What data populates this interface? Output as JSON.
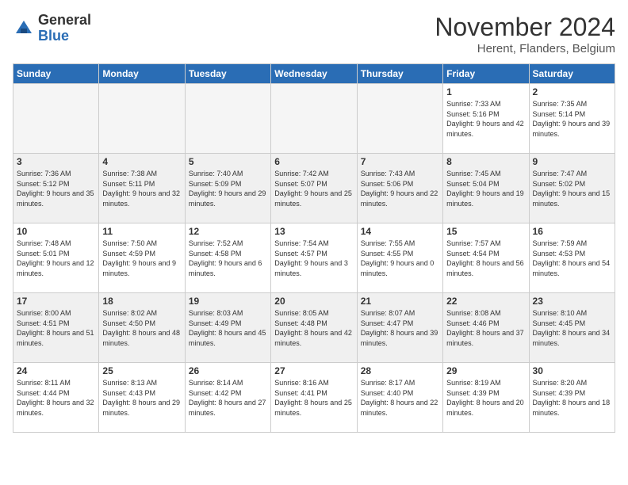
{
  "logo": {
    "general": "General",
    "blue": "Blue"
  },
  "title": "November 2024",
  "location": "Herent, Flanders, Belgium",
  "headers": [
    "Sunday",
    "Monday",
    "Tuesday",
    "Wednesday",
    "Thursday",
    "Friday",
    "Saturday"
  ],
  "weeks": [
    {
      "shaded": false,
      "days": [
        {
          "num": "",
          "info": ""
        },
        {
          "num": "",
          "info": ""
        },
        {
          "num": "",
          "info": ""
        },
        {
          "num": "",
          "info": ""
        },
        {
          "num": "",
          "info": ""
        },
        {
          "num": "1",
          "info": "Sunrise: 7:33 AM\nSunset: 5:16 PM\nDaylight: 9 hours\nand 42 minutes."
        },
        {
          "num": "2",
          "info": "Sunrise: 7:35 AM\nSunset: 5:14 PM\nDaylight: 9 hours\nand 39 minutes."
        }
      ]
    },
    {
      "shaded": true,
      "days": [
        {
          "num": "3",
          "info": "Sunrise: 7:36 AM\nSunset: 5:12 PM\nDaylight: 9 hours\nand 35 minutes."
        },
        {
          "num": "4",
          "info": "Sunrise: 7:38 AM\nSunset: 5:11 PM\nDaylight: 9 hours\nand 32 minutes."
        },
        {
          "num": "5",
          "info": "Sunrise: 7:40 AM\nSunset: 5:09 PM\nDaylight: 9 hours\nand 29 minutes."
        },
        {
          "num": "6",
          "info": "Sunrise: 7:42 AM\nSunset: 5:07 PM\nDaylight: 9 hours\nand 25 minutes."
        },
        {
          "num": "7",
          "info": "Sunrise: 7:43 AM\nSunset: 5:06 PM\nDaylight: 9 hours\nand 22 minutes."
        },
        {
          "num": "8",
          "info": "Sunrise: 7:45 AM\nSunset: 5:04 PM\nDaylight: 9 hours\nand 19 minutes."
        },
        {
          "num": "9",
          "info": "Sunrise: 7:47 AM\nSunset: 5:02 PM\nDaylight: 9 hours\nand 15 minutes."
        }
      ]
    },
    {
      "shaded": false,
      "days": [
        {
          "num": "10",
          "info": "Sunrise: 7:48 AM\nSunset: 5:01 PM\nDaylight: 9 hours\nand 12 minutes."
        },
        {
          "num": "11",
          "info": "Sunrise: 7:50 AM\nSunset: 4:59 PM\nDaylight: 9 hours\nand 9 minutes."
        },
        {
          "num": "12",
          "info": "Sunrise: 7:52 AM\nSunset: 4:58 PM\nDaylight: 9 hours\nand 6 minutes."
        },
        {
          "num": "13",
          "info": "Sunrise: 7:54 AM\nSunset: 4:57 PM\nDaylight: 9 hours\nand 3 minutes."
        },
        {
          "num": "14",
          "info": "Sunrise: 7:55 AM\nSunset: 4:55 PM\nDaylight: 9 hours\nand 0 minutes."
        },
        {
          "num": "15",
          "info": "Sunrise: 7:57 AM\nSunset: 4:54 PM\nDaylight: 8 hours\nand 56 minutes."
        },
        {
          "num": "16",
          "info": "Sunrise: 7:59 AM\nSunset: 4:53 PM\nDaylight: 8 hours\nand 54 minutes."
        }
      ]
    },
    {
      "shaded": true,
      "days": [
        {
          "num": "17",
          "info": "Sunrise: 8:00 AM\nSunset: 4:51 PM\nDaylight: 8 hours\nand 51 minutes."
        },
        {
          "num": "18",
          "info": "Sunrise: 8:02 AM\nSunset: 4:50 PM\nDaylight: 8 hours\nand 48 minutes."
        },
        {
          "num": "19",
          "info": "Sunrise: 8:03 AM\nSunset: 4:49 PM\nDaylight: 8 hours\nand 45 minutes."
        },
        {
          "num": "20",
          "info": "Sunrise: 8:05 AM\nSunset: 4:48 PM\nDaylight: 8 hours\nand 42 minutes."
        },
        {
          "num": "21",
          "info": "Sunrise: 8:07 AM\nSunset: 4:47 PM\nDaylight: 8 hours\nand 39 minutes."
        },
        {
          "num": "22",
          "info": "Sunrise: 8:08 AM\nSunset: 4:46 PM\nDaylight: 8 hours\nand 37 minutes."
        },
        {
          "num": "23",
          "info": "Sunrise: 8:10 AM\nSunset: 4:45 PM\nDaylight: 8 hours\nand 34 minutes."
        }
      ]
    },
    {
      "shaded": false,
      "days": [
        {
          "num": "24",
          "info": "Sunrise: 8:11 AM\nSunset: 4:44 PM\nDaylight: 8 hours\nand 32 minutes."
        },
        {
          "num": "25",
          "info": "Sunrise: 8:13 AM\nSunset: 4:43 PM\nDaylight: 8 hours\nand 29 minutes."
        },
        {
          "num": "26",
          "info": "Sunrise: 8:14 AM\nSunset: 4:42 PM\nDaylight: 8 hours\nand 27 minutes."
        },
        {
          "num": "27",
          "info": "Sunrise: 8:16 AM\nSunset: 4:41 PM\nDaylight: 8 hours\nand 25 minutes."
        },
        {
          "num": "28",
          "info": "Sunrise: 8:17 AM\nSunset: 4:40 PM\nDaylight: 8 hours\nand 22 minutes."
        },
        {
          "num": "29",
          "info": "Sunrise: 8:19 AM\nSunset: 4:39 PM\nDaylight: 8 hours\nand 20 minutes."
        },
        {
          "num": "30",
          "info": "Sunrise: 8:20 AM\nSunset: 4:39 PM\nDaylight: 8 hours\nand 18 minutes."
        }
      ]
    }
  ]
}
